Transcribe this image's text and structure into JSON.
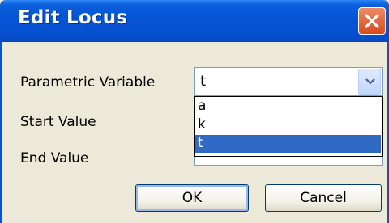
{
  "dialog": {
    "title": "Edit Locus",
    "close_icon": "close-icon"
  },
  "form": {
    "parametric_variable_label": "Parametric Variable",
    "start_value_label": "Start Value",
    "end_value_label": "End Value",
    "parametric_variable_value": "t",
    "dropdown_options": [
      "a",
      "k",
      "t"
    ],
    "selected_option": "t"
  },
  "buttons": {
    "ok": "OK",
    "cancel": "Cancel"
  },
  "colors": {
    "title_bar": "#0553d6",
    "dialog_bg": "#ece9d8",
    "selection": "#316ac5",
    "close_button": "#e05a2c"
  }
}
